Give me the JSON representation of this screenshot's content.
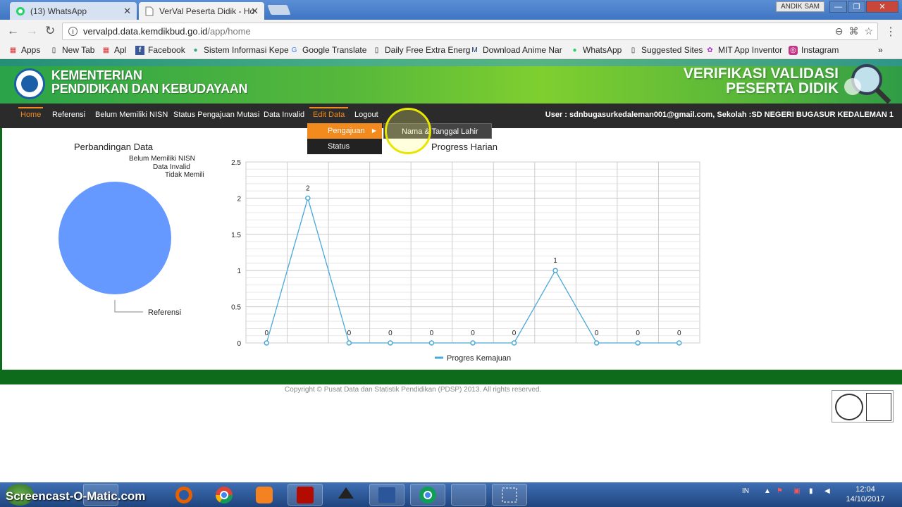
{
  "browser": {
    "tabs": [
      {
        "title": "(13) WhatsApp"
      },
      {
        "title": "VerVal Peserta Didik - Ho"
      }
    ],
    "profile_name": "ANDIK SAM",
    "url_host": "vervalpd.data.kemdikbud.go.id",
    "url_path": "/app/home",
    "bookmarks": [
      "Apps",
      "New Tab",
      "Apl",
      "Facebook",
      "Sistem Informasi Kepe",
      "Google Translate",
      "Daily Free Extra Energ",
      "Download Anime Nar",
      "WhatsApp",
      "Suggested Sites",
      "MIT App Inventor",
      "Instagram"
    ]
  },
  "header": {
    "ministry_line1": "KEMENTERIAN",
    "ministry_line2": "PENDIDIKAN DAN KEBUDAYAAN",
    "app_line1": "VERIFIKASI VALIDASI",
    "app_line2": "PESERTA DIDIK"
  },
  "nav": {
    "items": [
      "Home",
      "Referensi",
      "Belum Memiliki NISN",
      "Status Pengajuan Mutasi",
      "Data Invalid",
      "Edit Data",
      "Logout"
    ],
    "user_info": "User : sdnbugasurkedaleman001@gmail.com, Sekolah :SD NEGERI BUGASUR KEDALEMAN 1",
    "dropdown": [
      "Pengajuan",
      "Status"
    ],
    "submenu": "Nama & Tanggal Lahir"
  },
  "pie_chart": {
    "title": "Perbandingan Data",
    "legend": [
      "Belum Memiliki NISN",
      "Data Invalid",
      "Tidak Memili"
    ],
    "slice_label": "Referensi",
    "color": "#6699ff"
  },
  "chart_data": {
    "type": "line",
    "title": "Progress Harian",
    "series": [
      {
        "name": "Progres Kemajuan",
        "values": [
          0,
          2,
          0,
          0,
          0,
          0,
          0,
          1,
          0,
          0,
          0
        ],
        "color": "#4aa8d8"
      }
    ],
    "ylim": [
      0,
      2.5
    ],
    "y_ticks": [
      "0",
      "0.5",
      "1",
      "1.5",
      "2",
      "2.5"
    ],
    "data_labels": [
      "0",
      "2",
      "0",
      "0",
      "0",
      "0",
      "0",
      "1",
      "0",
      "0",
      "0"
    ],
    "grid": true,
    "legend_position": "bottom"
  },
  "footer": {
    "copyright": "Copyright © Pusat Data dan Statistik Pendidikan (PDSP) 2013. All rights reserved."
  },
  "taskbar": {
    "watermark": "Screencast-O-Matic.com",
    "lang": "IN",
    "time": "12:04",
    "date": "14/10/2017"
  }
}
